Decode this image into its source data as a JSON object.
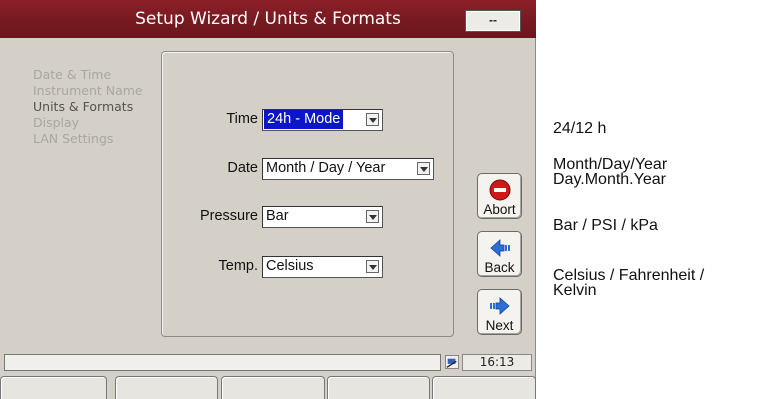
{
  "window": {
    "title": "Setup Wizard / Units & Formats",
    "corner_button_label": "--"
  },
  "wizard_steps": [
    {
      "label": "Date & Time",
      "active": false
    },
    {
      "label": "Instrument Name",
      "active": false
    },
    {
      "label": "Units & Formats",
      "active": true
    },
    {
      "label": "Display",
      "active": false
    },
    {
      "label": "LAN Settings",
      "active": false
    }
  ],
  "fields": {
    "time": {
      "label": "Time",
      "value": "24h - Mode",
      "selected": true
    },
    "date": {
      "label": "Date",
      "value": "Month / Day / Year"
    },
    "pressure": {
      "label": "Pressure",
      "value": "Bar"
    },
    "temp": {
      "label": "Temp.",
      "value": "Celsius"
    }
  },
  "buttons": {
    "abort": "Abort",
    "back": "Back",
    "next": "Next"
  },
  "status": {
    "message": "",
    "time": "16:13"
  },
  "softkeys": [
    "",
    "",
    "",
    "",
    ""
  ],
  "annotations": {
    "time": [
      "24/12 h"
    ],
    "date": [
      "Month/Day/Year",
      "Day.Month.Year"
    ],
    "pressure": [
      "Bar / PSI / kPa"
    ],
    "temp": [
      "Celsius / Fahrenheit /",
      "Kelvin"
    ]
  },
  "colors": {
    "titlebar": "#741a20",
    "selection": "#0a16c8",
    "abort_icon": "#d01818",
    "arrow_icon": "#2a6fd8"
  },
  "icons": {
    "abort": "stop-icon",
    "back": "arrow-left-icon",
    "next": "arrow-right-icon",
    "status": "network-icon"
  }
}
